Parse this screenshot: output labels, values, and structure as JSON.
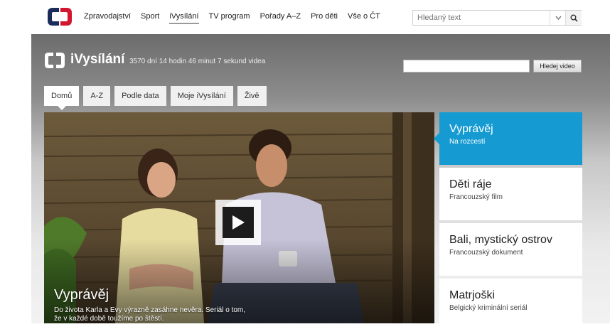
{
  "colors": {
    "accent": "#159bd2",
    "brand_red": "#d1162d",
    "brand_navy": "#1c2c5a"
  },
  "top_nav": {
    "logo": "ct-logo-icon",
    "items": [
      {
        "label": "Zpravodajství",
        "active": false
      },
      {
        "label": "Sport",
        "active": false
      },
      {
        "label": "iVysílání",
        "active": true
      },
      {
        "label": "TV program",
        "active": false
      },
      {
        "label": "Pořady A–Z",
        "active": false
      },
      {
        "label": "Pro děti",
        "active": false
      },
      {
        "label": "Vše o ČT",
        "active": false
      }
    ],
    "search": {
      "placeholder": "Hledaný text",
      "dropdown_icon": "chevron-down-icon",
      "button_icon": "search-icon"
    }
  },
  "ivysilani": {
    "title": "iVysílání",
    "counter": "3570 dní 14 hodin 46 minut 7 sekund videa",
    "search_button": "Hledej video",
    "tabs": [
      {
        "label": "Domů",
        "active": true
      },
      {
        "label": "A-Z",
        "active": false
      },
      {
        "label": "Podle data",
        "active": false
      },
      {
        "label": "Moje iVysílání",
        "active": false
      },
      {
        "label": "Živě",
        "active": false
      }
    ]
  },
  "hero": {
    "title": "Vyprávěj",
    "description": "Do života Karla a Evy výrazně zasáhne nevěra. Seriál o tom, že v každé době toužíme po štěstí.",
    "play_icon": "play-icon"
  },
  "side_list": [
    {
      "title": "Vyprávěj",
      "subtitle": "Na rozcestí",
      "active": true
    },
    {
      "title": "Děti ráje",
      "subtitle": "Francouzský film",
      "active": false
    },
    {
      "title": "Bali, mystický ostrov",
      "subtitle": "Francouzský dokument",
      "active": false
    },
    {
      "title": "Matrjoški",
      "subtitle": "Belgický kriminální seriál",
      "active": false
    }
  ]
}
